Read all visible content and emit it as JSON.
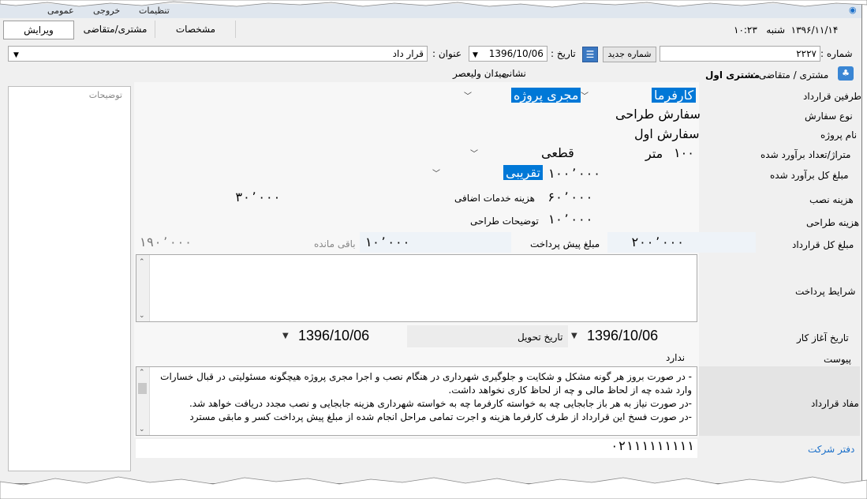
{
  "menu": {
    "items": [
      "تنظیمات",
      "خروجی",
      "عمومی"
    ]
  },
  "header": {
    "time": "۱۰:۲۳",
    "day": "شنبه",
    "date": "۱۳۹۶/۱۱/۱۴"
  },
  "tabs": [
    {
      "label": "ویرایش",
      "active": true
    },
    {
      "label": "مشتری/متقاضی"
    },
    {
      "label": "مشخصات"
    }
  ],
  "form": {
    "number_label": "شماره :",
    "number_value": "۲۲۲۷",
    "new_number_button": "شماره جدید",
    "date_label": "تاریخ :",
    "date_value": "1396/10/06",
    "title_label": "عنوان :",
    "title_value": "قرار داد",
    "customer_label": "مشتری / متقاضی :",
    "customer_value": "مشتری اول",
    "address_label": "نشانی : ",
    "address_value": "میدان ولیعصر",
    "notes_label": "توضیحات"
  },
  "rows": {
    "parties_label": "طرفین قرارداد",
    "party1": "کارفرما",
    "party2": "مجری پروژه",
    "order_type_label": "نوع سفارش",
    "order_type_value": "سفارش طراحی",
    "project_name_label": "نام پروژه",
    "project_name_value": "سفارش اول",
    "area_label": "متراژ/تعداد برآورد شده",
    "area_value": "۱۰۰",
    "area_unit": "متر",
    "area_kind": "قطعی",
    "estimate_label": "مبلغ کل برآورد شده",
    "estimate_value": "۱۰۰٬۰۰۰",
    "estimate_kind": "تقریبی",
    "install_label": "هزینه نصب",
    "install_value": "۳۰٬۰۰۰",
    "extra_label": "هزینه خدمات اضافی",
    "extra_value": "۶۰٬۰۰۰",
    "design_label": "هزینه طراحی",
    "design_value": "۱۰٬۰۰۰",
    "design_notes_label": "توضیحات طراحی",
    "total_label": "مبلغ کل قرارداد",
    "total_value": "۲۰۰٬۰۰۰",
    "prepay_label": "مبلغ پیش پرداخت",
    "prepay_value": "۱۰٬۰۰۰",
    "remaining_label": "باقی مانده",
    "remaining_value": "۱۹۰٬۰۰۰",
    "payment_terms_label": "شرایط پرداخت",
    "start_date_label": "تاریخ آغاز کار",
    "start_date_value": "1396/10/06",
    "delivery_label": "تاریخ تحویل",
    "delivery_value": "1396/10/06",
    "attachment_label": "پیوست",
    "attachment_value": "ندارد",
    "clauses_label": "مفاد قرارداد",
    "clause1": "- در صورت بروز هر گونه مشکل و شکایت و جلوگیری شهرداری در هنگام نصب و اجرا مجری پروژه هیچگونه مسئولیتی در قبال خسارات وارد شده چه از لحاظ مالی و چه از لحاظ کاری نخواهد داشت.",
    "clause2": "-در صورت نیاز به هر باز جابجایی چه به خواسته کارفرما چه به خواسته شهرداری هزینه جابجایی و نصب مجدد دریافت خواهد شد.",
    "clause3": "-در صورت فسخ این قرارداد از طرف کارفرما هزینه و اجرت تمامی مراحل انجام شده از مبلغ پیش پرداخت کسر و مابقی مسترد",
    "office_label": "دفتر شرکت",
    "office_value": "۰۲۱۱۱۱۱۱۱۱۱"
  },
  "colors": {
    "accent": "#0078d7",
    "link": "#1a6fc9"
  }
}
